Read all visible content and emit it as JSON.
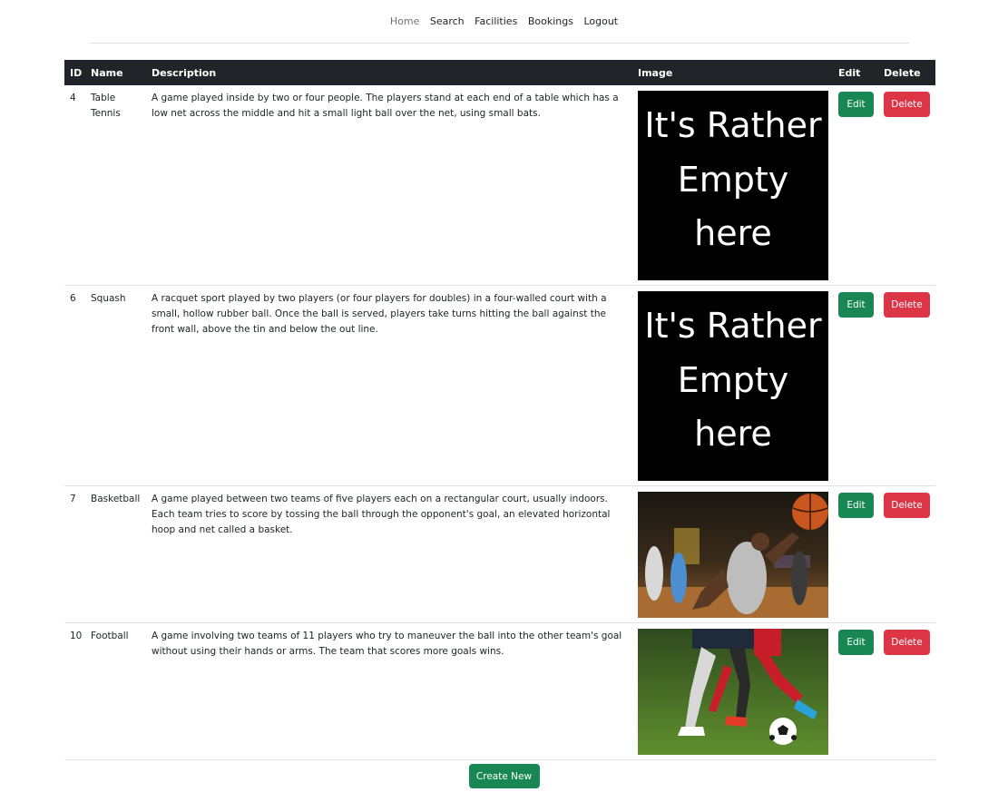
{
  "nav": {
    "items": [
      {
        "label": "Home",
        "active": true
      },
      {
        "label": "Search"
      },
      {
        "label": "Facilities"
      },
      {
        "label": "Bookings"
      },
      {
        "label": "Logout"
      }
    ]
  },
  "table": {
    "headers": {
      "id": "ID",
      "name": "Name",
      "description": "Description",
      "image": "Image",
      "edit": "Edit",
      "delete": "Delete"
    },
    "rows": [
      {
        "id": "4",
        "name": "Table Tennis",
        "description": "A game played inside by two or four people. The players stand at each end of a table which has a low net across the middle and hit a small light ball over the net, using small bats.",
        "image": {
          "kind": "placeholder",
          "lines": [
            "It's Rather",
            "Empty",
            "here"
          ]
        },
        "edit_label": "Edit",
        "delete_label": "Delete"
      },
      {
        "id": "6",
        "name": "Squash",
        "description": "A racquet sport played by two players (or four players for doubles) in a four-walled court with a small, hollow rubber ball. Once the ball is served, players take turns hitting the ball against the front wall, above the tin and below the out line.",
        "image": {
          "kind": "placeholder",
          "lines": [
            "It's Rather",
            "Empty",
            "here"
          ]
        },
        "edit_label": "Edit",
        "delete_label": "Delete"
      },
      {
        "id": "7",
        "name": "Basketball",
        "description": "A game played between two teams of five players each on a rectangular court, usually indoors. Each team tries to score by tossing the ball through the opponent's goal, an elevated horizontal hoop and net called a basket.",
        "image": {
          "kind": "photo",
          "subject": "basketball-photo"
        },
        "edit_label": "Edit",
        "delete_label": "Delete"
      },
      {
        "id": "10",
        "name": "Football",
        "description": "A game involving two teams of 11 players who try to maneuver the ball into the other team's goal without using their hands or arms. The team that scores more goals wins.",
        "image": {
          "kind": "photo",
          "subject": "football-photo"
        },
        "edit_label": "Edit",
        "delete_label": "Delete"
      }
    ]
  },
  "create_label": "Create New",
  "colors": {
    "header_bg": "#212529",
    "edit": "#198754",
    "delete": "#dc3545",
    "create": "#198754"
  }
}
